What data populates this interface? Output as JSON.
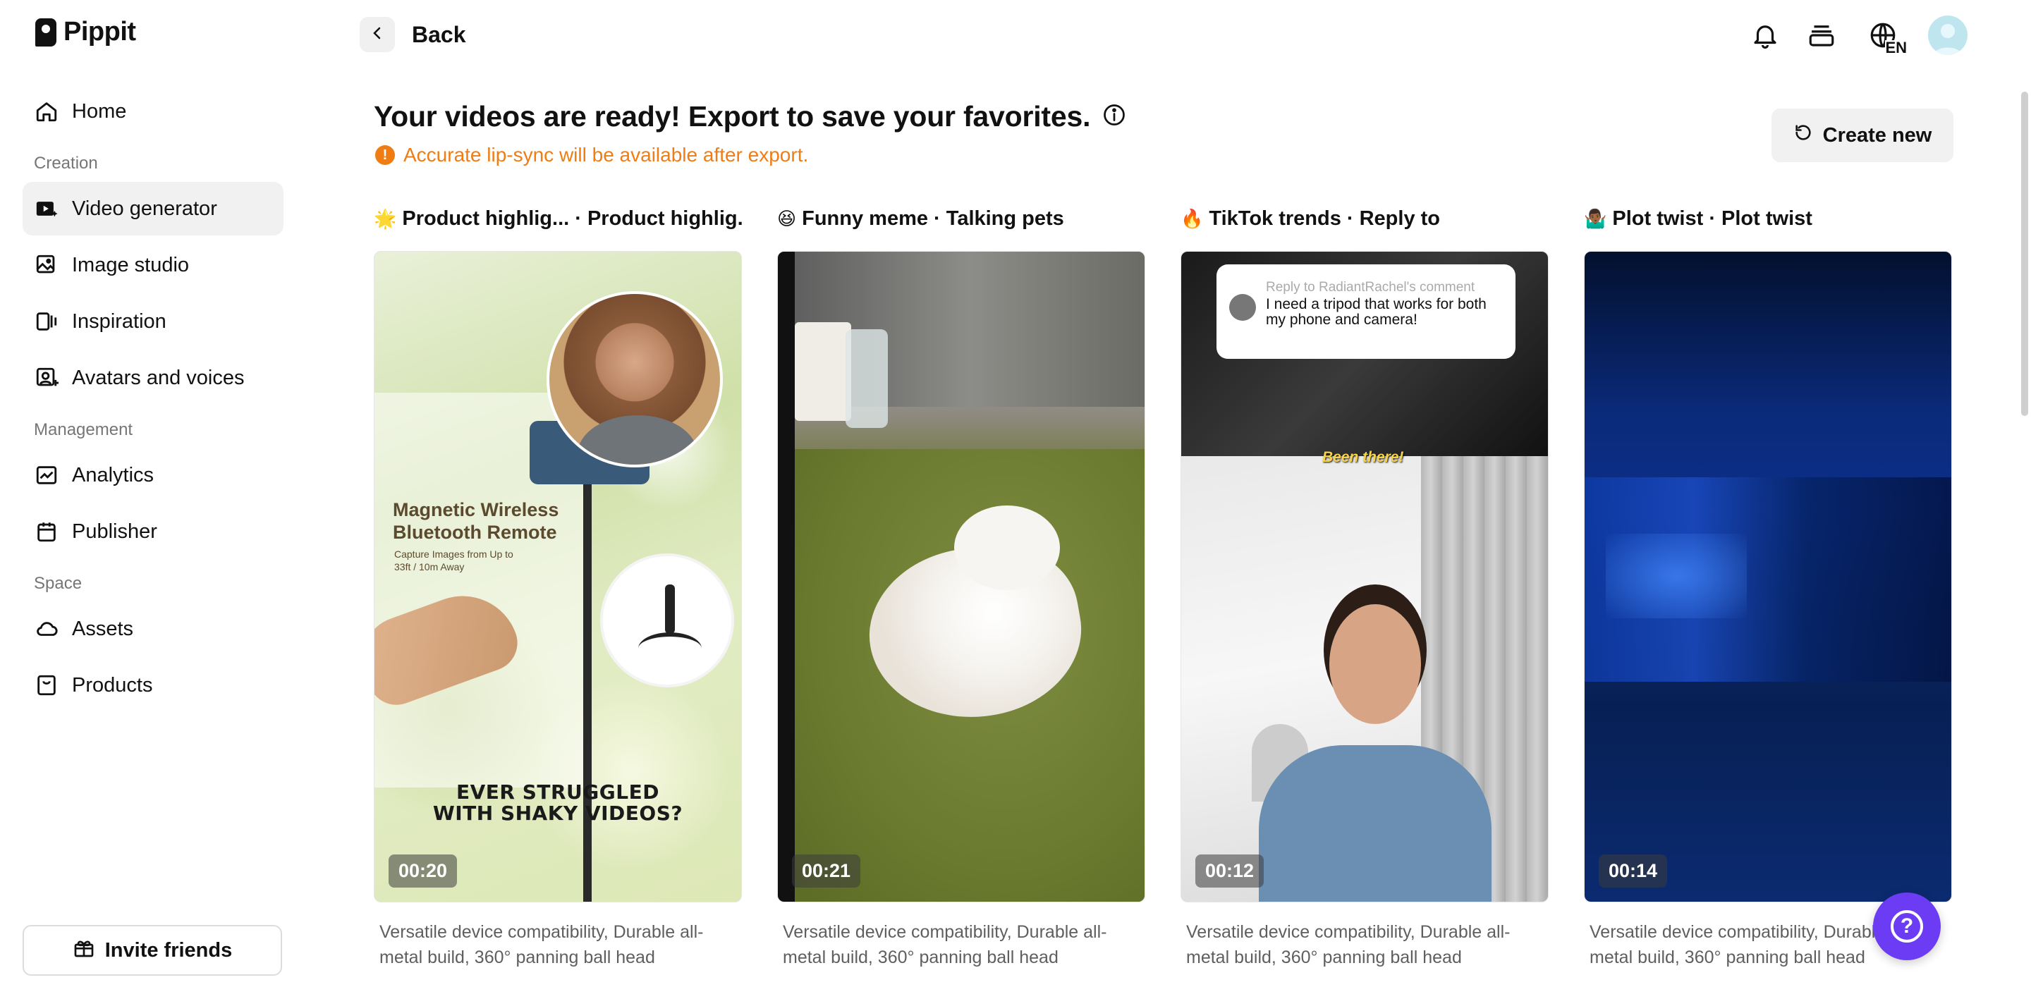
{
  "brand": {
    "name": "Pippit"
  },
  "sidebar": {
    "items": [
      {
        "label": "Home",
        "icon": "home-icon"
      }
    ],
    "sections": [
      {
        "title": "Creation",
        "items": [
          {
            "label": "Video generator",
            "icon": "video-generator-icon",
            "active": true
          },
          {
            "label": "Image studio",
            "icon": "image-studio-icon"
          },
          {
            "label": "Inspiration",
            "icon": "inspiration-icon"
          },
          {
            "label": "Avatars and voices",
            "icon": "avatar-voice-icon"
          }
        ]
      },
      {
        "title": "Management",
        "items": [
          {
            "label": "Analytics",
            "icon": "analytics-icon"
          },
          {
            "label": "Publisher",
            "icon": "calendar-icon"
          }
        ]
      },
      {
        "title": "Space",
        "items": [
          {
            "label": "Assets",
            "icon": "cloud-icon"
          },
          {
            "label": "Products",
            "icon": "product-box-icon"
          }
        ]
      }
    ],
    "invite_label": "Invite friends"
  },
  "header": {
    "back_label": "Back",
    "language_badge": "EN"
  },
  "main": {
    "headline": "Your videos are ready! Export to save your favorites.",
    "notice": "Accurate lip-sync will be available after export.",
    "notice_icon": "!",
    "create_new_label": "Create new"
  },
  "cards": [
    {
      "emoji": "🌟",
      "title": "Product highlig... · Product highlig...",
      "duration": "00:20",
      "description": "Versatile device compatibility, Durable all-metal build, 360° panning ball head",
      "overlay": {
        "title": "Magnetic Wireless Bluetooth Remote",
        "subtitle": "Capture Images from Up to 33ft / 10m Away",
        "caption": "EVER STRUGGLED WITH SHAKY VIDEOS?"
      }
    },
    {
      "emoji": "😆",
      "title": "Funny meme · Talking pets",
      "duration": "00:21",
      "description": "Versatile device compatibility, Durable all-metal build, 360° panning ball head"
    },
    {
      "emoji": "🔥",
      "title": "TikTok trends · Reply to",
      "duration": "00:12",
      "description": "Versatile device compatibility, Durable all-metal build, 360° panning ball head",
      "overlay": {
        "reply_to": "Reply to RadiantRachel's comment",
        "comment": "I need a tripod that works for both my phone and camera!",
        "caption": "Been there!"
      }
    },
    {
      "emoji": "🤷🏾‍♂️",
      "title": "Plot twist · Plot twist",
      "duration": "00:14",
      "description": "Versatile device compatibility, Durable all-metal build, 360° panning ball head"
    }
  ],
  "help": {
    "label": "?"
  },
  "colors": {
    "accent_orange": "#ef7d14",
    "help_purple": "#6c3cf4",
    "active_bg": "#f1f1f1"
  }
}
